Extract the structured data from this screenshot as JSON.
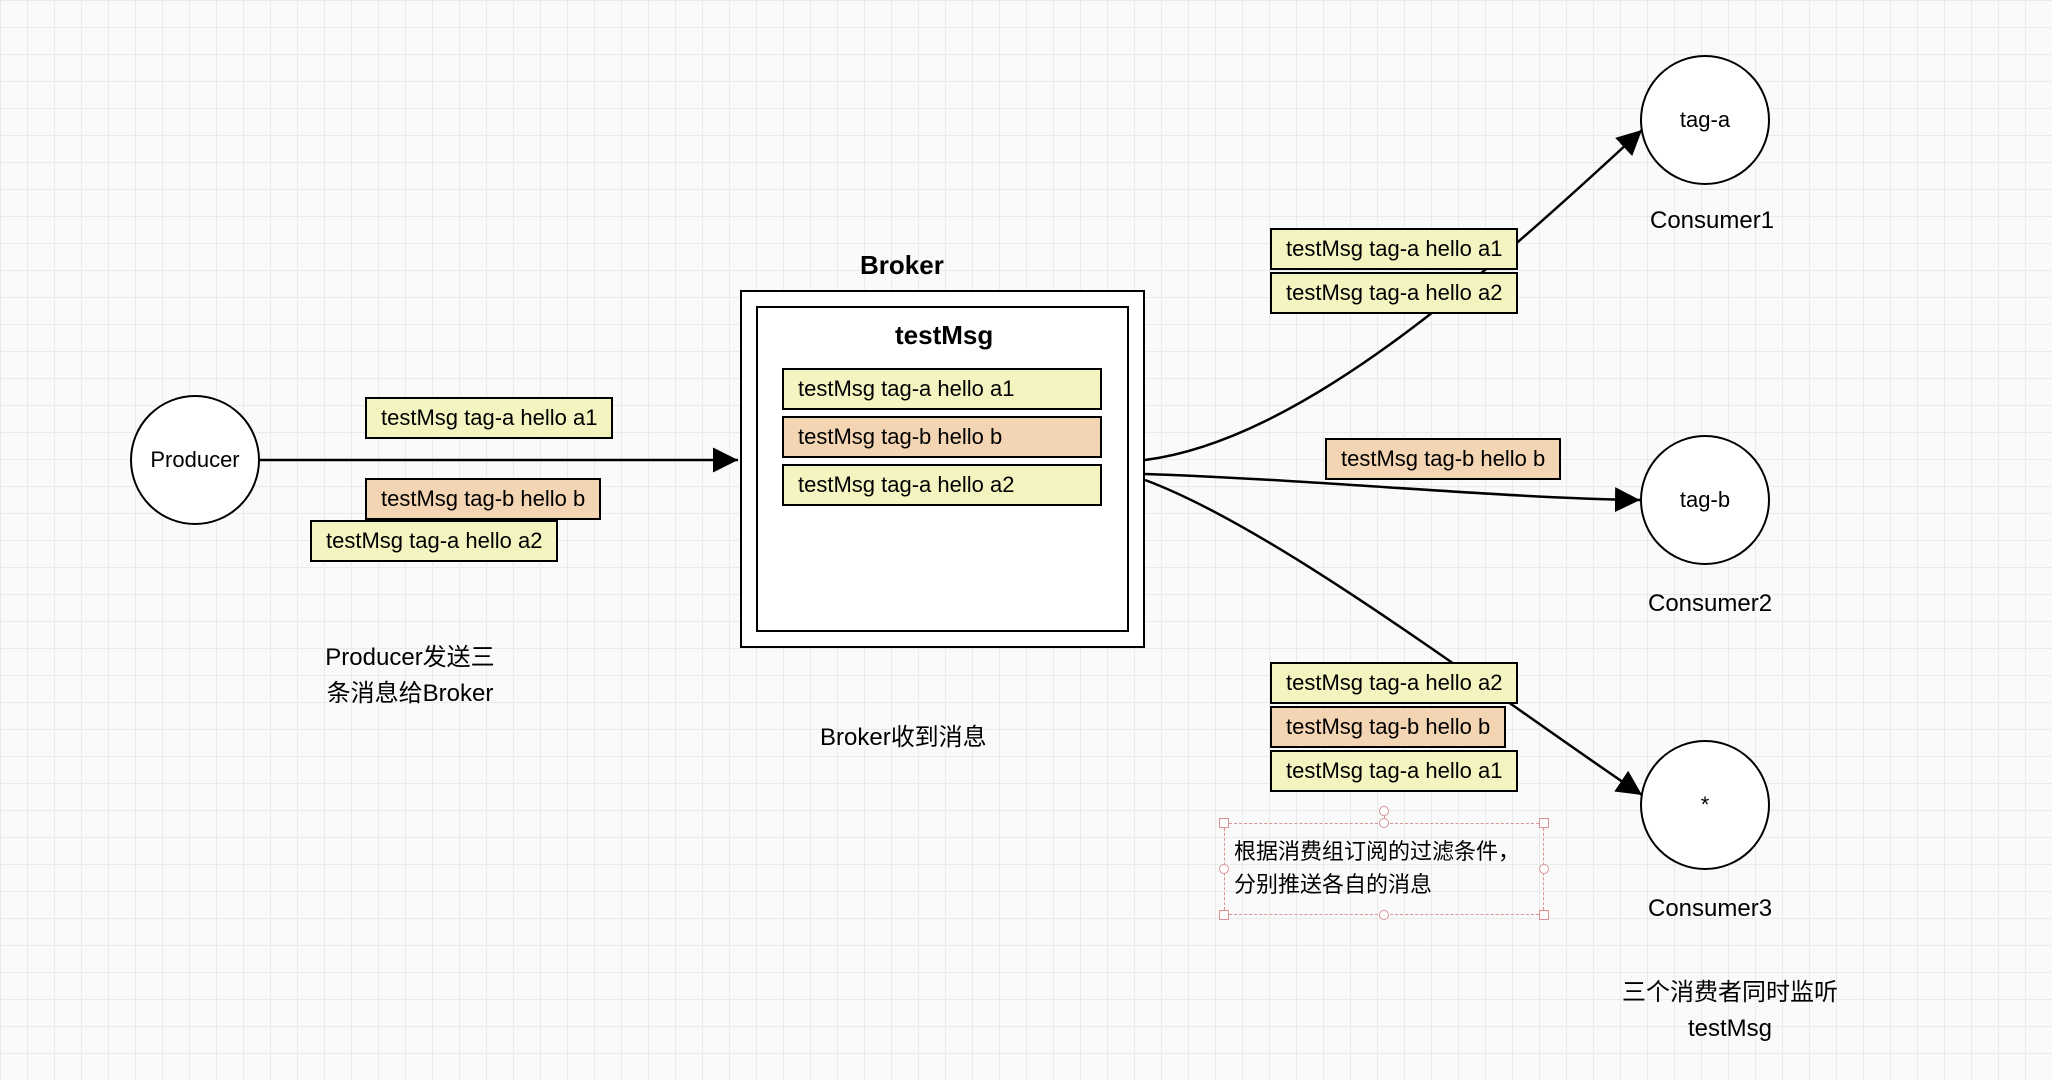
{
  "nodes": {
    "producer": "Producer",
    "consumer1": "tag-a",
    "consumer2": "tag-b",
    "consumer3": "*",
    "consumer1_label": "Consumer1",
    "consumer2_label": "Consumer2",
    "consumer3_label": "Consumer3"
  },
  "broker": {
    "title": "Broker",
    "topic": "testMsg",
    "msg1": "testMsg  tag-a  hello a1",
    "msg2": "testMsg  tag-b  hello b",
    "msg3": "testMsg  tag-a  hello a2"
  },
  "producer_msgs": {
    "m1": "testMsg  tag-a  hello a1",
    "m2": "testMsg  tag-b  hello b",
    "m3": "testMsg  tag-a  hello a2"
  },
  "consumer1_msgs": {
    "m1": "testMsg  tag-a  hello a1",
    "m2": "testMsg  tag-a  hello a2"
  },
  "consumer2_msgs": {
    "m1": "testMsg  tag-b  hello b"
  },
  "consumer3_msgs": {
    "m1": "testMsg  tag-a  hello a2",
    "m2": "testMsg  tag-b  hello b",
    "m3": "testMsg  tag-a  hello a1"
  },
  "captions": {
    "producer": "Producer发送三\n条消息给Broker",
    "broker": "Broker收到消息",
    "filter": "根据消费组订阅的过滤条件，分别推送各自的消息",
    "consumers": "三个消费者同时监听\ntestMsg"
  }
}
